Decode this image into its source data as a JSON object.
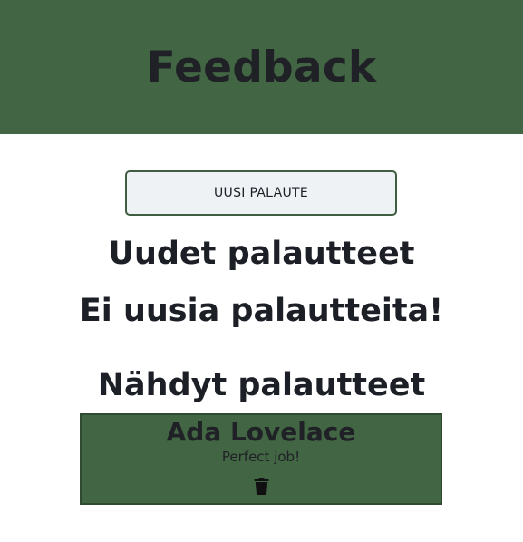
{
  "header": {
    "title": "Feedback"
  },
  "actions": {
    "new_feedback_label": "UUSI PALAUTE"
  },
  "sections": {
    "new_title": "Uudet palautteet",
    "new_empty_text": "Ei uusia palautteita!",
    "seen_title": "Nähdyt palautteet"
  },
  "seen_feedback": [
    {
      "name": "Ada Lovelace",
      "message": "Perfect job!",
      "delete_icon": "trash-icon"
    }
  ],
  "colors": {
    "header_bg": "#426543",
    "card_bg": "#426543",
    "button_bg": "#eef2f5",
    "button_border": "#3f5d40",
    "text": "#1c1f26"
  }
}
